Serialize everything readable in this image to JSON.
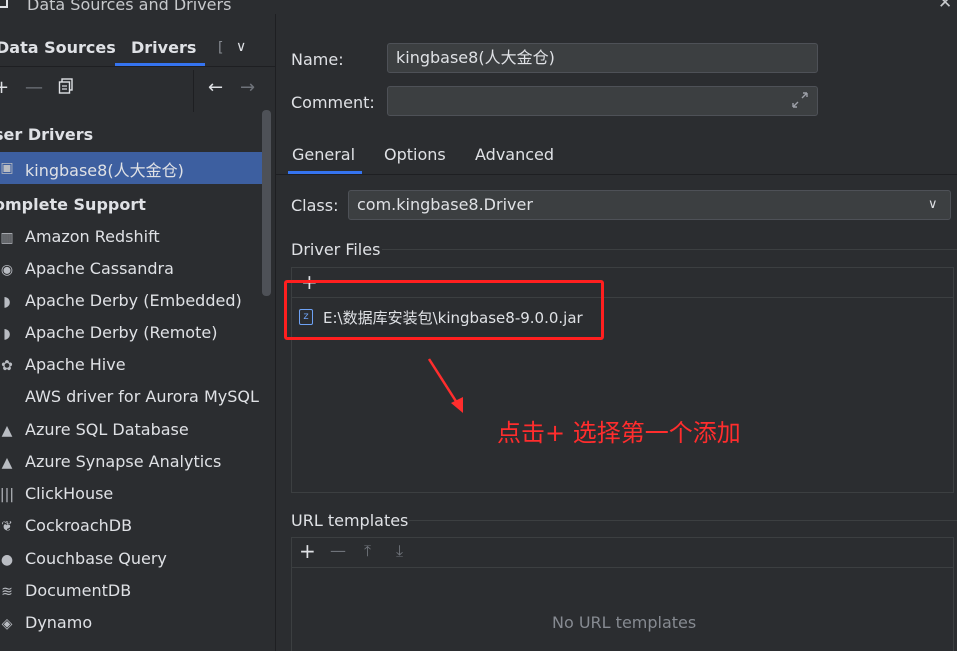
{
  "window": {
    "title": "Data Sources and Drivers"
  },
  "left_tabs": {
    "data_sources": "Data Sources",
    "drivers": "Drivers",
    "more": "["
  },
  "sections": {
    "user_drivers": "ser Drivers",
    "complete_support": "omplete Support"
  },
  "selected_driver": "kingbase8(人大金仓)",
  "driver_list": [
    "Amazon Redshift",
    "Apache Cassandra",
    "Apache Derby (Embedded)",
    "Apache Derby (Remote)",
    "Apache Hive",
    "AWS driver for Aurora MySQL",
    "Azure SQL Database",
    "Azure Synapse Analytics",
    "ClickHouse",
    "CockroachDB",
    "Couchbase Query",
    "DocumentDB",
    "Dynamo"
  ],
  "form": {
    "name_label": "Name:",
    "name_value": "kingbase8(人大金仓)",
    "comment_label": "Comment:",
    "comment_value": ""
  },
  "right_tabs": {
    "general": "General",
    "options": "Options",
    "advanced": "Advanced"
  },
  "class_field": {
    "label": "Class:",
    "value": "com.kingbase8.Driver"
  },
  "driver_files": {
    "title": "Driver Files",
    "file": "E:\\数据库安装包\\kingbase8-9.0.0.jar"
  },
  "url_templates": {
    "title": "URL templates",
    "empty": "No URL templates"
  },
  "annotation": "点击+ 选择第一个添加",
  "colors": {
    "accent": "#3574f0",
    "selection": "#3d5fa0",
    "annotation": "#ff2d2d"
  }
}
